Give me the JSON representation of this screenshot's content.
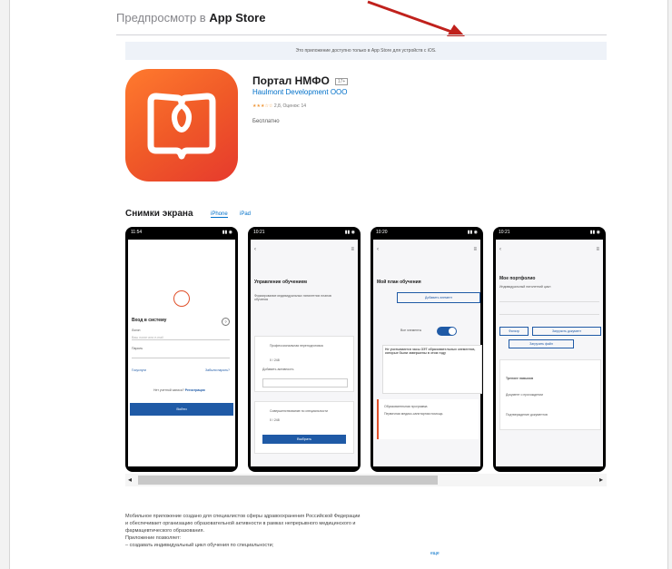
{
  "header": {
    "prefix": "Предпросмотр в ",
    "bold": "App Store"
  },
  "notice": "Это приложение доступно только в App Store для устройств с iOS.",
  "app": {
    "title": "Портал НМФО",
    "age": "17+",
    "developer": "Haulmont Development OOO",
    "stars": "★★★☆☆",
    "rating": "2,8, Оценок: 14",
    "price": "Бесплатно"
  },
  "screenshots": {
    "title": "Снимки экрана",
    "tabs": [
      "iPhone",
      "iPad"
    ]
  },
  "phones": [
    {
      "time": "11:54",
      "login_title": "Вход в систему",
      "login": "Логин",
      "login_ph": "Ваш логин или e-mail",
      "password": "Пароль",
      "esia": "Госуслуги",
      "forgot": "Забыли пароль?",
      "register_q": "Нет учетной записи?",
      "register": "Регистрация",
      "enter": "Войти"
    },
    {
      "time": "10:21",
      "h1": "Управление обучением",
      "t1": "Формирование индивидуальных пятилетних планов обучения",
      "card1": "Профессиональная переподготовка",
      "card1_val": "0 / 248",
      "add": "Добавить активность",
      "card2": "Совершенствование по специальности",
      "card2_val": "0 / 248",
      "btn": "Выбрать"
    },
    {
      "time": "10:20",
      "h1": "Мой план обучения",
      "add": "Добавить элемент",
      "toggle_label": "Все элементы",
      "notice": "Не учитываются часы ЗЭТ образовательных элементов, которые были завершены в этом году",
      "item": "Образовательная программа",
      "item_t": "Первичная медико-санитарная помощь"
    },
    {
      "time": "10:21",
      "h1": "Мое портфолио",
      "t1": "Индивидуальный пятилетний цикл",
      "filter": "Фильтр",
      "add": "Загрузить документ",
      "btn": "Загрузить файл",
      "item": "Тренинг навыков",
      "item_t": "Документ о прохождении",
      "footer": "Подтверждение документов"
    }
  ],
  "description": [
    "Мобильное приложение создано для специалистов сферы здравоохранения Российской Федерации",
    "и обеспечивает организацию образовательной активности в рамках непрерывного медицинского и",
    "фармацевтического образования.",
    "Приложение позволяет:",
    "– создавать индивидуальный цикл обучения по специальности;"
  ],
  "more": "еще"
}
